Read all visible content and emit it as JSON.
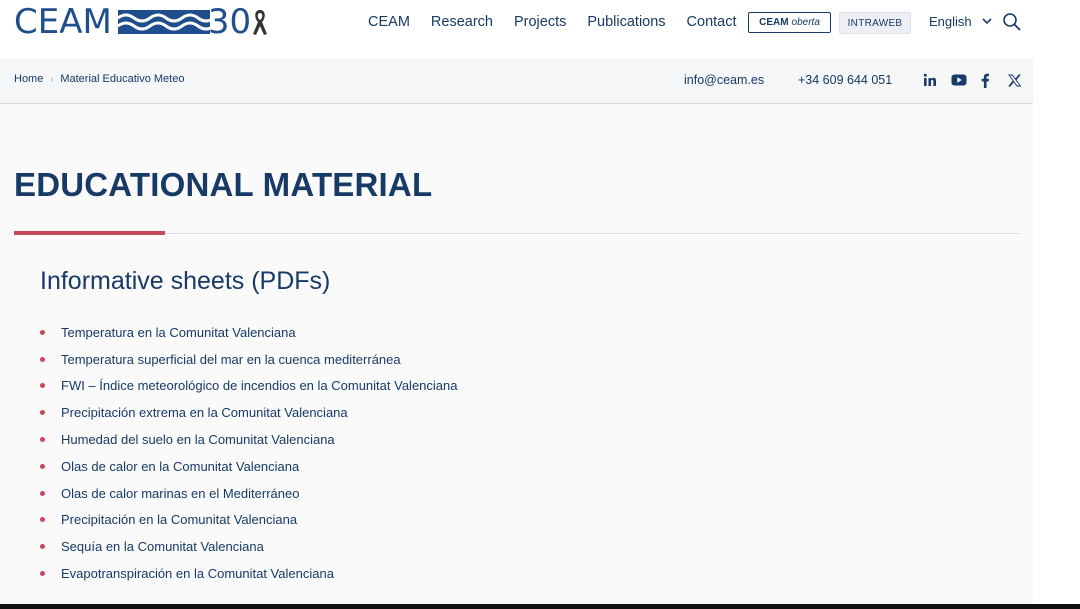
{
  "brand": {
    "name": "CEAM",
    "anniversary": "30",
    "colors": {
      "primary": "#173a66",
      "accent": "#c8475a",
      "logo_blue": "#1f4e8c"
    }
  },
  "nav": {
    "items": [
      {
        "label": "CEAM"
      },
      {
        "label": "Research"
      },
      {
        "label": "Projects"
      },
      {
        "label": "Publications"
      },
      {
        "label": "Contact"
      }
    ],
    "oberta_bold": "CEAM",
    "oberta_italic": "oberta",
    "intraweb": "INTRAWEB",
    "language": "English"
  },
  "breadcrumb": {
    "home": "Home",
    "current": "Material Educativo Meteo"
  },
  "contact": {
    "email": "info@ceam.es",
    "phone": "+34 609 644 051"
  },
  "social": [
    "linkedin-icon",
    "youtube-icon",
    "facebook-icon",
    "x-icon"
  ],
  "page": {
    "title": "EDUCATIONAL MATERIAL",
    "section_title": "Informative sheets (PDFs)"
  },
  "pdfs": [
    "Temperatura en la Comunitat Valenciana",
    "Temperatura superficial del mar en la cuenca mediterránea",
    "FWI – Índice meteorológico de incendios en la Comunitat Valenciana",
    "Precipitación extrema en la Comunitat Valenciana",
    "Humedad del suelo en la Comunitat Valenciana",
    "Olas de calor en la Comunitat Valenciana",
    "Olas de calor marinas en el Mediterráneo",
    "Precipitación en la Comunitat Valenciana",
    "Sequía en la Comunitat Valenciana",
    "Evapotranspiración en la Comunitat Valenciana"
  ]
}
